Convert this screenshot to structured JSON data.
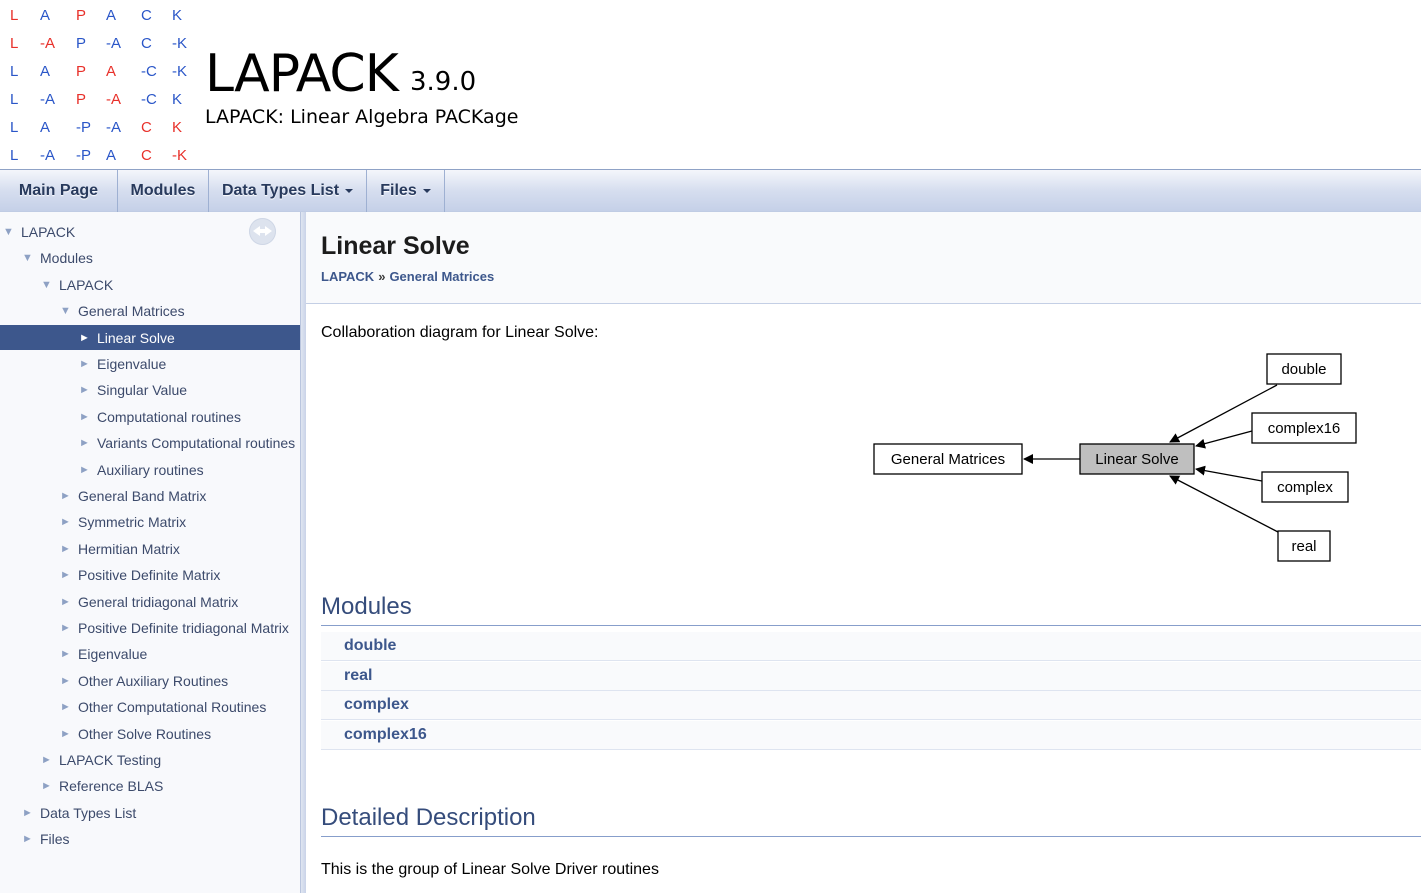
{
  "logo": {
    "rows": [
      [
        "L",
        "A",
        "P",
        "A",
        "C",
        "K"
      ],
      [
        "L",
        "-A",
        "P",
        "-A",
        "C",
        "-K"
      ],
      [
        "L",
        "A",
        "P",
        "A",
        "-C",
        "-K"
      ],
      [
        "L",
        "-A",
        "P",
        "-A",
        "-C",
        "K"
      ],
      [
        "L",
        "A",
        "-P",
        "-A",
        "C",
        "K"
      ],
      [
        "L",
        "-A",
        "-P",
        "A",
        "C",
        "-K"
      ]
    ],
    "colors": [
      [
        "red",
        "blue",
        "red",
        "blue",
        "blue",
        "blue"
      ],
      [
        "red",
        "red",
        "blue",
        "blue",
        "blue",
        "blue"
      ],
      [
        "blue",
        "blue",
        "red",
        "red",
        "blue",
        "blue"
      ],
      [
        "blue",
        "blue",
        "red",
        "red",
        "blue",
        "blue"
      ],
      [
        "blue",
        "blue",
        "blue",
        "blue",
        "red",
        "red"
      ],
      [
        "blue",
        "blue",
        "blue",
        "blue",
        "red",
        "red"
      ]
    ],
    "red": "#e8302a",
    "blue": "#2a56c8"
  },
  "project": {
    "name": "LAPACK",
    "number": "3.9.0",
    "brief": "LAPACK: Linear Algebra PACKage"
  },
  "nav": {
    "main_page": "Main Page",
    "modules": "Modules",
    "data_types": "Data Types List",
    "files": "Files"
  },
  "tree": [
    {
      "label": "LAPACK",
      "level": 0,
      "arrow": "▼"
    },
    {
      "label": "Modules",
      "level": 1,
      "arrow": "▼"
    },
    {
      "label": "LAPACK",
      "level": 2,
      "arrow": "▼"
    },
    {
      "label": "General Matrices",
      "level": 3,
      "arrow": "▼"
    },
    {
      "label": "Linear Solve",
      "level": 4,
      "arrow": "►",
      "selected": true
    },
    {
      "label": "Eigenvalue",
      "level": 4,
      "arrow": "►"
    },
    {
      "label": "Singular Value",
      "level": 4,
      "arrow": "►"
    },
    {
      "label": "Computational routines",
      "level": 4,
      "arrow": "►"
    },
    {
      "label": "Variants Computational routines",
      "level": 4,
      "arrow": "►"
    },
    {
      "label": "Auxiliary routines",
      "level": 4,
      "arrow": "►"
    },
    {
      "label": "General Band Matrix",
      "level": 3,
      "arrow": "►"
    },
    {
      "label": "Symmetric Matrix",
      "level": 3,
      "arrow": "►"
    },
    {
      "label": "Hermitian Matrix",
      "level": 3,
      "arrow": "►"
    },
    {
      "label": "Positive Definite Matrix",
      "level": 3,
      "arrow": "►"
    },
    {
      "label": "General tridiagonal Matrix",
      "level": 3,
      "arrow": "►"
    },
    {
      "label": "Positive Definite tridiagonal Matrix",
      "level": 3,
      "arrow": "►"
    },
    {
      "label": "Eigenvalue",
      "level": 3,
      "arrow": "►"
    },
    {
      "label": "Other Auxiliary Routines",
      "level": 3,
      "arrow": "►"
    },
    {
      "label": "Other Computational Routines",
      "level": 3,
      "arrow": "►"
    },
    {
      "label": "Other Solve Routines",
      "level": 3,
      "arrow": "►"
    },
    {
      "label": "LAPACK Testing",
      "level": 2,
      "arrow": "►"
    },
    {
      "label": "Reference BLAS",
      "level": 2,
      "arrow": "►"
    },
    {
      "label": "Data Types List",
      "level": 1,
      "arrow": "►"
    },
    {
      "label": "Files",
      "level": 1,
      "arrow": "►"
    }
  ],
  "content": {
    "title": "Linear Solve",
    "breadcrumb": [
      "LAPACK",
      "General Matrices"
    ],
    "breadcrumb_sep": "»",
    "collab_text": "Collaboration diagram for Linear Solve:",
    "modules_title": "Modules",
    "modules": [
      "double",
      "real",
      "complex",
      "complex16"
    ],
    "detail_title": "Detailed Description",
    "detail_text": "This is the group of Linear Solve Driver routines"
  },
  "diagram": {
    "center": "Linear Solve",
    "parent": "General Matrices",
    "children": [
      "double",
      "complex16",
      "complex",
      "real"
    ],
    "center_fill": "#bfbfbf"
  }
}
